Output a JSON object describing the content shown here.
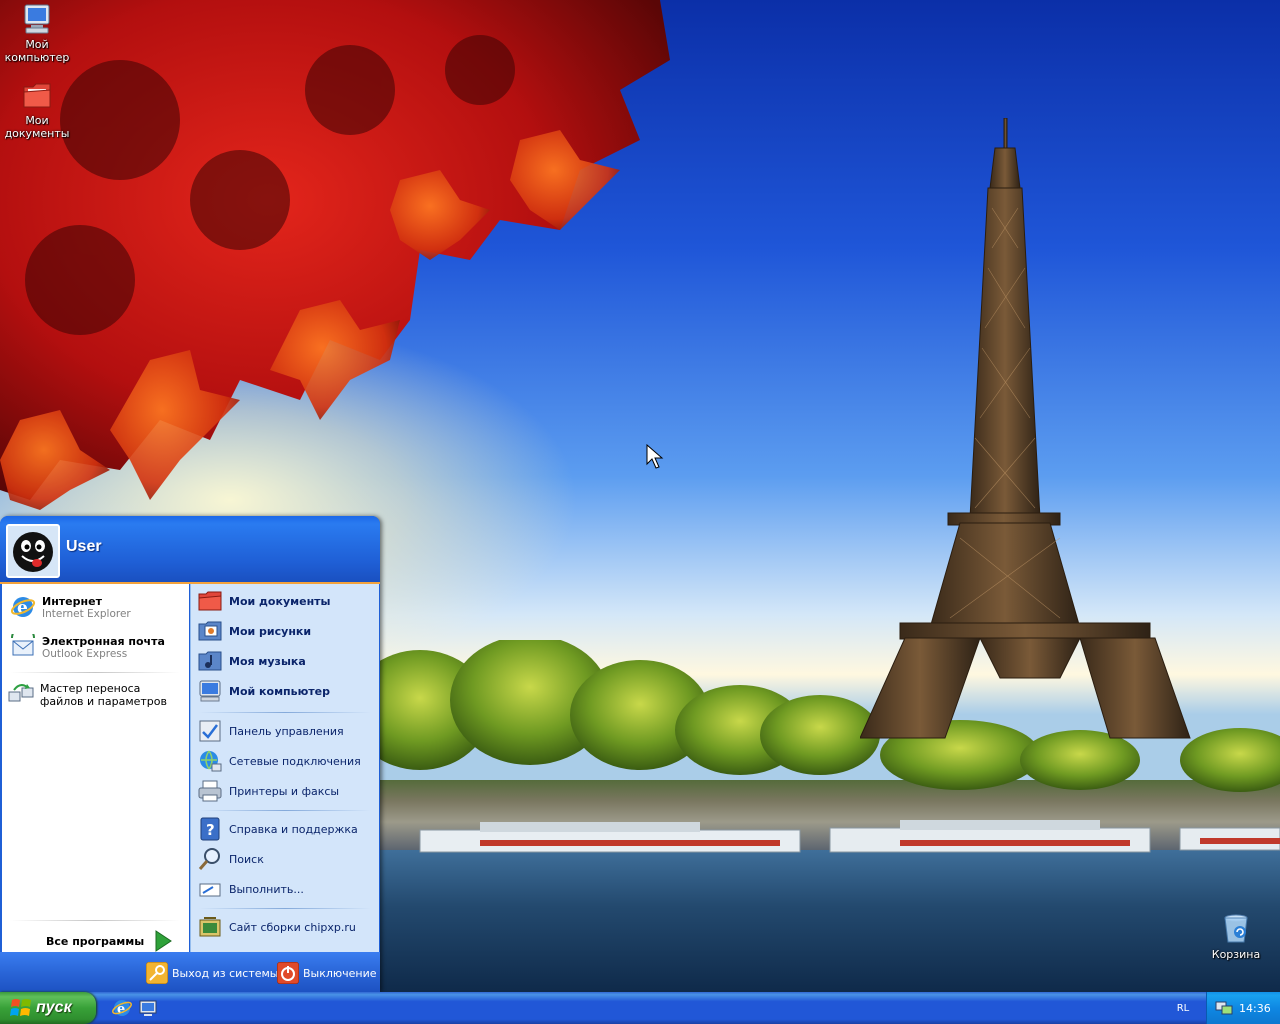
{
  "desktop": {
    "icons": [
      {
        "label": "Мой компьютер",
        "icon": "my-computer-icon"
      },
      {
        "label": "Мои документы",
        "icon": "my-documents-icon"
      },
      {
        "label": "Корзина",
        "icon": "recycle-bin-icon"
      }
    ]
  },
  "start_menu": {
    "username": "User",
    "pinned": [
      {
        "title": "Интернет",
        "subtitle": "Internet Explorer",
        "icon": "internet-explorer-icon"
      },
      {
        "title": "Электронная почта",
        "subtitle": "Outlook Express",
        "icon": "outlook-express-icon"
      }
    ],
    "recent": [
      {
        "label": "Мастер переноса файлов и параметров",
        "icon": "transfer-wizard-icon"
      }
    ],
    "all_programs_label": "Все программы",
    "right_bold": [
      {
        "label": "Мои документы",
        "icon": "my-documents-icon"
      },
      {
        "label": "Мои рисунки",
        "icon": "my-pictures-icon"
      },
      {
        "label": "Моя музыка",
        "icon": "my-music-icon"
      },
      {
        "label": "Мой компьютер",
        "icon": "my-computer-icon"
      }
    ],
    "right_group2": [
      {
        "label": "Панель управления",
        "icon": "control-panel-icon"
      },
      {
        "label": "Сетевые подключения",
        "icon": "network-icon"
      },
      {
        "label": "Принтеры и факсы",
        "icon": "printer-icon"
      }
    ],
    "right_group3": [
      {
        "label": "Справка и поддержка",
        "icon": "help-icon"
      },
      {
        "label": "Поиск",
        "icon": "search-icon"
      },
      {
        "label": "Выполнить...",
        "icon": "run-icon"
      }
    ],
    "right_group4": [
      {
        "label": "Сайт сборки chipxp.ru",
        "icon": "website-icon"
      }
    ],
    "footer": {
      "logoff_label": "Выход из системы",
      "shutdown_label": "Выключение"
    }
  },
  "taskbar": {
    "start_label": "пуск",
    "quicklaunch": [
      "internet-explorer-icon",
      "show-desktop-icon"
    ],
    "language": "RL",
    "clock": "14:36"
  },
  "colors": {
    "start_green": "#38a138",
    "taskbar_blue": "#2157d7",
    "tray_blue": "#0f88e3",
    "menu_header_blue": "#1f5fd6",
    "menu_right_bg": "#d3e5fa"
  }
}
